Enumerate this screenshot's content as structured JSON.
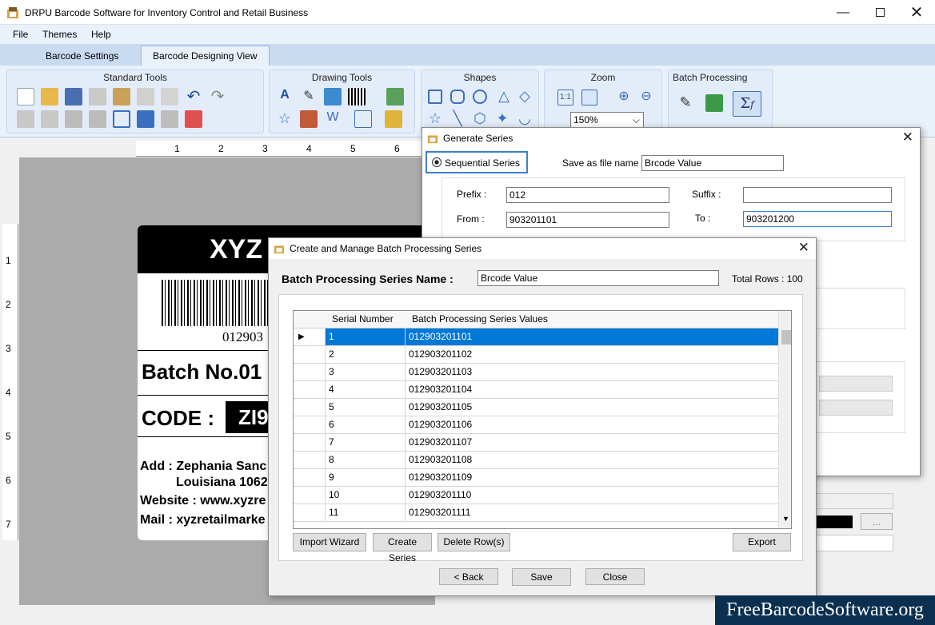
{
  "window": {
    "title": "DRPU Barcode Software for Inventory Control and Retail Business"
  },
  "menu": [
    "File",
    "Themes",
    "Help"
  ],
  "tabs": [
    "Barcode Settings",
    "Barcode Designing View"
  ],
  "ribbon": {
    "groups": [
      "Standard Tools",
      "Drawing Tools",
      "Shapes",
      "Zoom",
      "Batch Processing"
    ],
    "zoom_value": "150%",
    "zoom_reset_label": "1:1"
  },
  "ruler": {
    "h_ticks": [
      "1",
      "2",
      "3",
      "4",
      "5",
      "6"
    ],
    "v_ticks": [
      "1",
      "2",
      "3",
      "4",
      "5",
      "6",
      "7"
    ]
  },
  "label_preview": {
    "header": "XYZ",
    "barcode_text": "012903",
    "batch": "Batch No.01",
    "code_label": "CODE :",
    "code_value": "ZI9",
    "address_line1": "Add : Zephania Sanc",
    "address_line2": "Louisiana 1062",
    "website": "Website : www.xyzre",
    "mail": "Mail : xyzretailmarke"
  },
  "generate_series": {
    "title": "Generate Series",
    "radio_label": "Sequential Series",
    "save_as_label": "Save as file name :",
    "save_as_value": "Brcode Value",
    "prefix_label": "Prefix :",
    "prefix_value": "012",
    "suffix_label": "Suffix :",
    "suffix_value": "",
    "from_label": "From :",
    "from_value": "903201101",
    "to_label": "To :",
    "to_value": "903201200"
  },
  "batch_dialog": {
    "title": "Create and Manage Batch Processing Series",
    "name_label": "Batch Processing Series Name :",
    "name_value": "Brcode Value",
    "total_rows": "Total Rows : 100",
    "columns": [
      "Serial Number",
      "Batch Processing Series Values"
    ],
    "rows": [
      [
        "1",
        "012903201101"
      ],
      [
        "2",
        "012903201102"
      ],
      [
        "3",
        "012903201103"
      ],
      [
        "4",
        "012903201104"
      ],
      [
        "5",
        "012903201105"
      ],
      [
        "6",
        "012903201106"
      ],
      [
        "7",
        "012903201107"
      ],
      [
        "8",
        "012903201108"
      ],
      [
        "9",
        "012903201109"
      ],
      [
        "10",
        "012903201110"
      ],
      [
        "11",
        "012903201111"
      ]
    ],
    "buttons": {
      "import": "Import Wizard",
      "create": "Create Series",
      "delete": "Delete Row(s)",
      "export": "Export",
      "back": "< Back",
      "save": "Save",
      "close": "Close"
    }
  },
  "watermark": "FreeBarcodeSoftware.org",
  "colors": {
    "selection": "#0078d7",
    "ribbon": "#e9f1fb",
    "tab_strip": "#c9dbf1"
  }
}
